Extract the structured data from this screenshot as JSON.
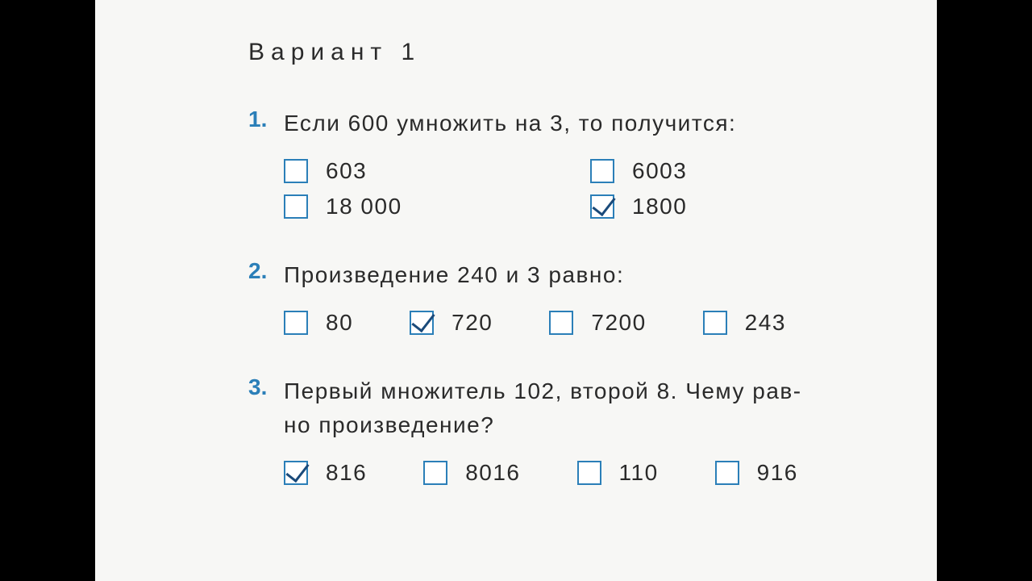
{
  "variant_title": "Вариант 1",
  "questions": [
    {
      "num": "1.",
      "text": "Если 600 умножить на 3, то получится:",
      "layout": "2col",
      "options": [
        {
          "label": "603",
          "checked": false
        },
        {
          "label": "6003",
          "checked": false
        },
        {
          "label": "18 000",
          "checked": false
        },
        {
          "label": "1800",
          "checked": true
        }
      ]
    },
    {
      "num": "2.",
      "text": "Произведение 240 и 3 равно:",
      "layout": "4col",
      "options": [
        {
          "label": "80",
          "checked": false
        },
        {
          "label": "720",
          "checked": true
        },
        {
          "label": "7200",
          "checked": false
        },
        {
          "label": "243",
          "checked": false
        }
      ]
    },
    {
      "num": "3.",
      "text": "Первый множитель 102, второй 8. Чему рав-\nно произведение?",
      "layout": "4col",
      "options": [
        {
          "label": "816",
          "checked": true
        },
        {
          "label": "8016",
          "checked": false
        },
        {
          "label": "110",
          "checked": false
        },
        {
          "label": "916",
          "checked": false
        }
      ]
    }
  ]
}
